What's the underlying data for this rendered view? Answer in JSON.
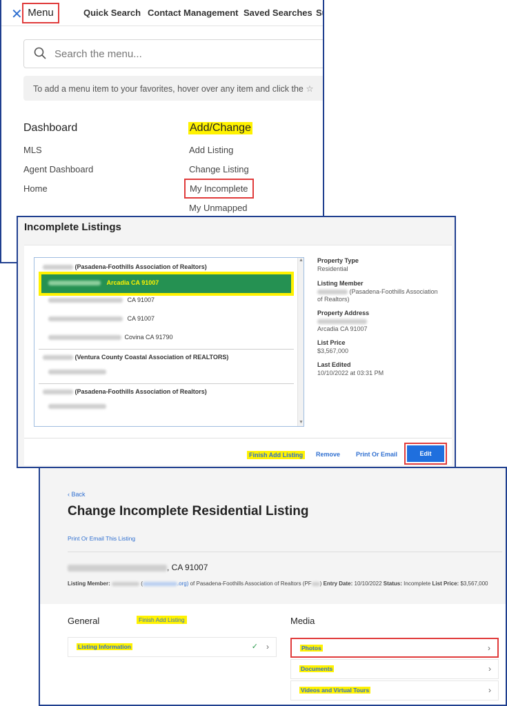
{
  "menu_panel": {
    "close_icon": "close-icon",
    "menu_tab": "Menu",
    "nav": [
      "Quick Search",
      "Contact Management",
      "Saved Searches",
      "Su"
    ],
    "search_placeholder": "Search the menu...",
    "favorites_tip": "To add a menu item to your favorites, hover over any item and click the",
    "dashboard": {
      "title": "Dashboard",
      "items": [
        "MLS",
        "Agent Dashboard",
        "Home"
      ]
    },
    "add_change": {
      "title": "Add/Change",
      "items": [
        "Add Listing",
        "Change Listing",
        "My Incomplete",
        "My Unmapped"
      ]
    }
  },
  "incomplete_panel": {
    "title": "Incomplete Listings",
    "groups": [
      {
        "association": "(Pasadena-Foothills Association of Realtors)",
        "rows": [
          {
            "text": "Arcadia CA 91007",
            "selected": true
          },
          {
            "text": "CA 91007",
            "selected": false
          },
          {
            "text": "CA 91007",
            "selected": false
          },
          {
            "text": "Covina CA 91790",
            "selected": false
          }
        ]
      },
      {
        "association": "(Ventura County Coastal Association of REALTORS)"
      },
      {
        "association": "(Pasadena-Foothills Association of Realtors)"
      }
    ],
    "details": {
      "property_type_label": "Property Type",
      "property_type": "Residential",
      "listing_member_label": "Listing Member",
      "listing_member_line1": "(Pasadena-Foothills Association",
      "listing_member_line2": "of Realtors)",
      "property_address_label": "Property Address",
      "property_address": "Arcadia CA 91007",
      "list_price_label": "List Price",
      "list_price": "$3,567,000",
      "last_edited_label": "Last Edited",
      "last_edited": "10/10/2022 at 03:31 PM"
    },
    "actions": {
      "finish_add_listing": "Finish Add Listing",
      "remove": "Remove",
      "print_or_email": "Print Or Email",
      "edit": "Edit"
    }
  },
  "change_panel": {
    "back": "Back",
    "heading": "Change Incomplete Residential Listing",
    "print_link": "Print Or Email This Listing",
    "address_suffix": ", CA 91007",
    "meta": {
      "listing_member_label": "Listing Member:",
      "email_domain": ".org)",
      "association": "of Pasadena-Foothills Association of Realtors (PF",
      "entry_date_label": "Entry Date:",
      "entry_date": "10/10/2022",
      "status_label": "Status:",
      "status": "Incomplete",
      "list_price_label": "List Price:",
      "list_price": "$3,567,000"
    },
    "general": {
      "title": "General",
      "finish_add_listing": "Finish Add Listing",
      "items": [
        "Listing Information"
      ]
    },
    "media": {
      "title": "Media",
      "items": [
        "Photos",
        "Documents",
        "Videos and Virtual Tours"
      ]
    },
    "colors": {
      "highlight": "#fff200",
      "annotation_red": "#e03a3a",
      "link_blue": "#2f6fd0",
      "selected_green": "#259152",
      "panel_border": "#1f3f8f"
    }
  }
}
